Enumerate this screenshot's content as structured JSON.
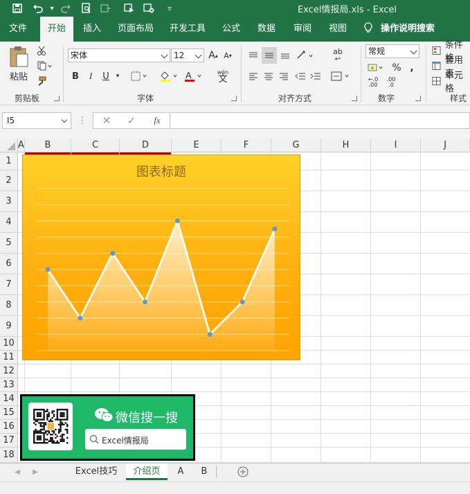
{
  "window": {
    "title": "Excel情报局.xls - Excel"
  },
  "ribbon_tabs": [
    "文件",
    "开始",
    "插入",
    "页面布局",
    "开发工具",
    "公式",
    "数据",
    "审阅",
    "视图"
  ],
  "active_tab": "开始",
  "tell_me": "操作说明搜索",
  "ribbon": {
    "clipboard": {
      "paste": "粘贴",
      "label": "剪贴板"
    },
    "font": {
      "name": "宋体",
      "size": "12",
      "label": "字体",
      "bold": "B",
      "italic": "I",
      "underline": "U",
      "grow": "A",
      "shrink": "A",
      "wen": "wén",
      "wen_char": "文"
    },
    "alignment": {
      "label": "对齐方式",
      "wrap_ab": "ab"
    },
    "number": {
      "format": "常规",
      "label": "数字",
      "percent": "%",
      "comma": ",",
      "inc_dec": ".00",
      "dec_dec": ".0"
    },
    "styles": {
      "items": [
        "条件格",
        "套用表",
        "单元格"
      ],
      "label": "样式"
    }
  },
  "formula_bar": {
    "name_box": "I5",
    "fx": "fx",
    "value": ""
  },
  "columns": [
    "A",
    "B",
    "C",
    "D",
    "E",
    "F",
    "G",
    "H",
    "I",
    "J"
  ],
  "rows": [
    "1",
    "2",
    "3",
    "4",
    "5",
    "6",
    "7",
    "8",
    "9",
    "10",
    "11",
    "12",
    "13",
    "14",
    "15",
    "16",
    "17",
    "18"
  ],
  "chart_data": {
    "type": "area",
    "title": "图表标题",
    "x": [
      1,
      2,
      3,
      4,
      5,
      6,
      7,
      8
    ],
    "series": [
      {
        "values": [
          50,
          20,
          60,
          30,
          80,
          10,
          30,
          75
        ]
      }
    ],
    "ylim": [
      0,
      100
    ],
    "grid": true,
    "colors": {
      "background_top": "#ffd028",
      "background_bottom": "#ffa300",
      "line": "#ffffff",
      "marker": "#5b9bd5"
    }
  },
  "promo": {
    "title": "微信搜一搜",
    "search_text": "Excel情报局"
  },
  "sheet_tabs": [
    "Excel技巧",
    "介绍页",
    "A",
    "B"
  ],
  "active_sheet": "介绍页",
  "colors": {
    "excel_green": "#217346",
    "promo_green": "#1fb868"
  }
}
